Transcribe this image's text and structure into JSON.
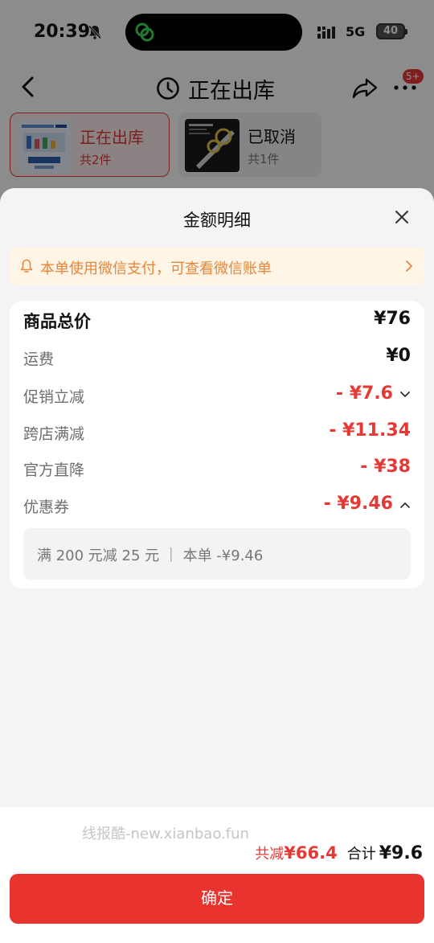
{
  "status_bar": {
    "time": "20:39",
    "network": "5G",
    "battery": "40"
  },
  "nav": {
    "title": "正在出库",
    "more_badge": "5+"
  },
  "packages": [
    {
      "title": "正在出库",
      "count": "共2件"
    },
    {
      "title": "已取消",
      "count": "共1件"
    }
  ],
  "sheet": {
    "title": "金额明细",
    "notice": "本单使用微信支付，可查看微信账单",
    "rows": [
      {
        "label": "商品总价",
        "value": "¥76"
      },
      {
        "label": "运费",
        "value": "¥0"
      },
      {
        "label": "促销立减",
        "value": "- ¥7.6"
      },
      {
        "label": "跨店满减",
        "value": "- ¥11.34"
      },
      {
        "label": "官方直降",
        "value": "- ¥38"
      },
      {
        "label": "优惠券",
        "value": "- ¥9.46"
      }
    ],
    "coupon_detail": "满 200 元减 25 元 ｜ 本单 -¥9.46"
  },
  "footer": {
    "watermark": "线报酷-new.xianbao.fun",
    "saved_label": "共减",
    "saved_value": "¥66.4",
    "total_label": "合计",
    "total_value": "¥9.6",
    "confirm_label": "确定"
  },
  "colors": {
    "accent": "#e53935",
    "button": "#e8332e",
    "notice_text": "#e8853a",
    "notice_bg": "#fef5e6"
  },
  "icons": [
    "bell-off-icon",
    "app-link-icon",
    "signal-icon",
    "back-icon",
    "clock-icon",
    "share-icon",
    "more-icon",
    "close-icon",
    "bell-icon",
    "chevron-right-icon",
    "chevron-down-icon",
    "chevron-up-icon"
  ]
}
